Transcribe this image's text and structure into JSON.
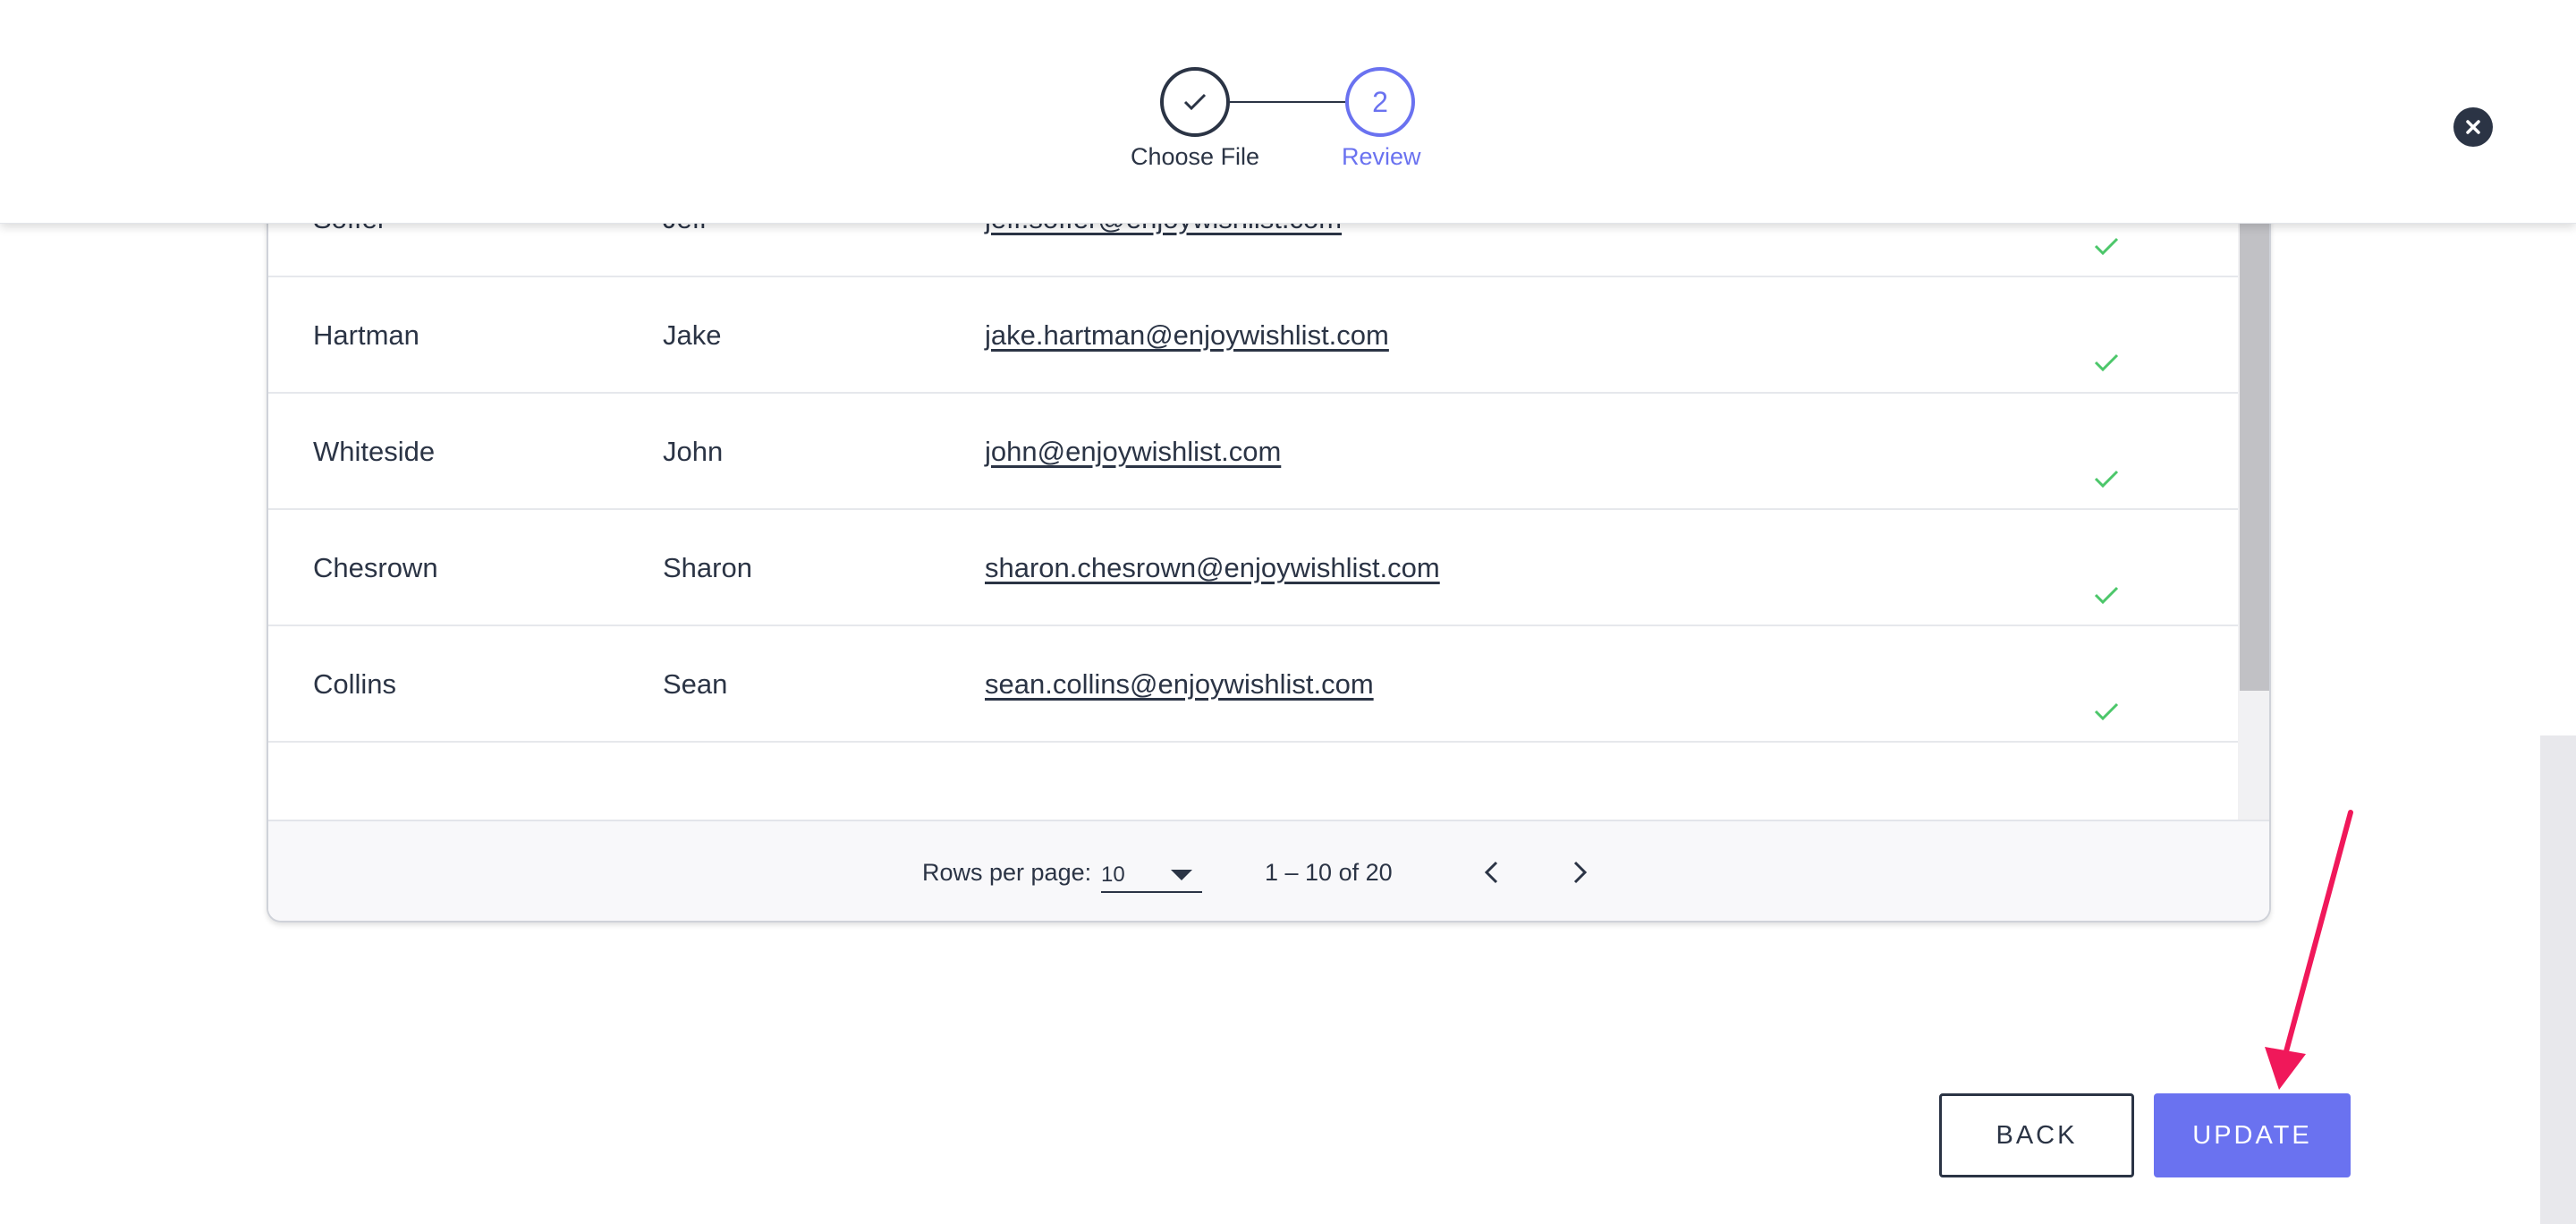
{
  "stepper": {
    "steps": [
      {
        "label": "Choose File",
        "state": "completed",
        "icon": "check-icon"
      },
      {
        "label": "Review",
        "number": "2",
        "state": "active"
      }
    ],
    "close_icon": "close-icon"
  },
  "table": {
    "rows": [
      {
        "last": "Soffer",
        "first": "Jeff",
        "email": "jeff.soffer@enjoywishlist.com",
        "status": "check-icon"
      },
      {
        "last": "Hartman",
        "first": "Jake",
        "email": "jake.hartman@enjoywishlist.com",
        "status": "check-icon"
      },
      {
        "last": "Whiteside",
        "first": "John",
        "email": "john@enjoywishlist.com",
        "status": "check-icon"
      },
      {
        "last": "Chesrown",
        "first": "Sharon",
        "email": "sharon.chesrown@enjoywishlist.com",
        "status": "check-icon"
      },
      {
        "last": "Collins",
        "first": "Sean",
        "email": "sean.collins@enjoywishlist.com",
        "status": "check-icon"
      }
    ],
    "pagination": {
      "rows_per_page_label": "Rows per page:",
      "rows_per_page_value": "10",
      "range": "1 – 10 of 20"
    }
  },
  "actions": {
    "back_label": "BACK",
    "update_label": "UPDATE"
  },
  "colors": {
    "accent": "#6a72f0",
    "text": "#2b3445",
    "success": "#4cc76a",
    "annotation": "#f0185a"
  }
}
